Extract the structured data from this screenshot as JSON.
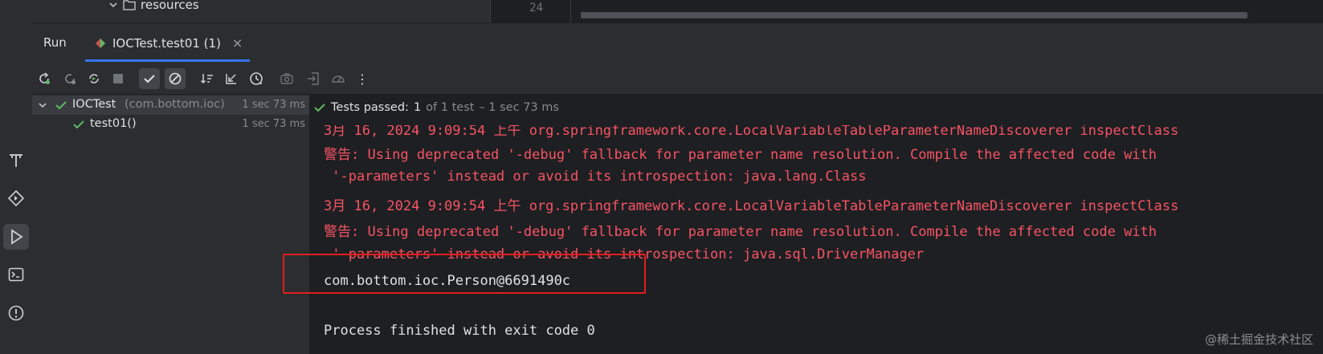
{
  "project_tree": {
    "folder_label": "resources"
  },
  "editor": {
    "line_number": "24"
  },
  "run_window": {
    "title": "Run",
    "tab_label": "IOCTest.test01 (1)",
    "tab_close": "×"
  },
  "toolbar": {
    "buttons": [
      "rerun-icon",
      "rerun-failed-icon",
      "toggle-auto-test-icon",
      "stop-icon",
      "show-passed-icon",
      "show-ignored-icon",
      "sort-icon",
      "collapse-icon",
      "history-icon",
      "screenshot-icon",
      "import-icon",
      "coverage-icon",
      "more-icon"
    ],
    "more_glyph": "⋮"
  },
  "test_tree": {
    "items": [
      {
        "name": "IOCTest",
        "package": "(com.bottom.ioc)",
        "time": "1 sec 73 ms"
      },
      {
        "name": "test01()",
        "time": "1 sec 73 ms"
      }
    ]
  },
  "status": {
    "prefix": "Tests passed:",
    "passed": "1",
    "of_total": "of 1 test",
    "duration": "– 1 sec 73 ms"
  },
  "console": {
    "lines": [
      "3月 16, 2024 9:09:54 上午 org.springframework.core.LocalVariableTableParameterNameDiscoverer inspectClass",
      "警告: Using deprecated '-debug' fallback for parameter name resolution. Compile the affected code with",
      " '-parameters' instead or avoid its introspection: java.lang.Class",
      "3月 16, 2024 9:09:54 上午 org.springframework.core.LocalVariableTableParameterNameDiscoverer inspectClass",
      "警告: Using deprecated '-debug' fallback for parameter name resolution. Compile the affected code with",
      " '-parameters' instead or avoid its introspection: java.sql.DriverManager",
      "com.bottom.ioc.Person@6691490c",
      "",
      "Process finished with exit code 0"
    ]
  },
  "watermark": "@稀土掘金技术社区",
  "colors": {
    "accent": "#3574f0",
    "pass": "#5fb865",
    "error": "#f75464",
    "highlight": "#e01e1e"
  }
}
